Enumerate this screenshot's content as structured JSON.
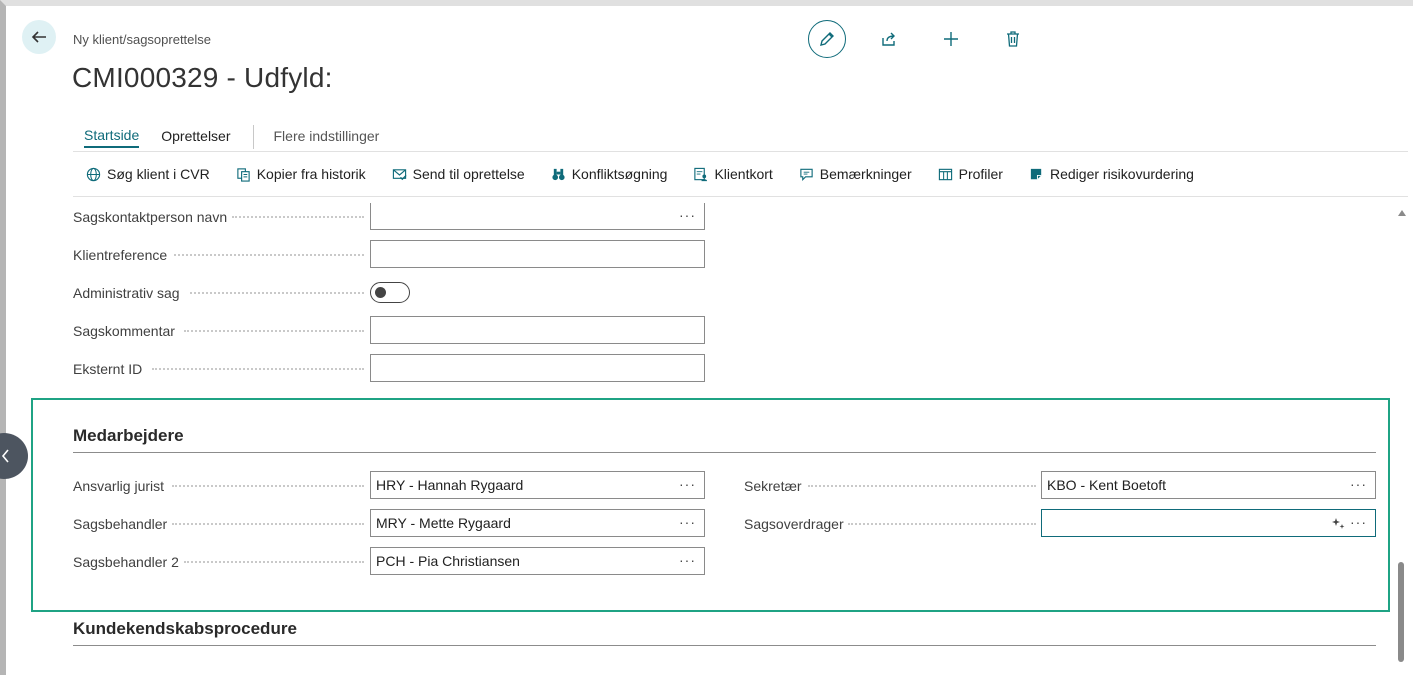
{
  "header": {
    "breadcrumb": "Ny klient/sagsoprettelse",
    "title": "CMI000329 - Udfyld:"
  },
  "tabs": [
    {
      "label": "Startside",
      "active": true
    },
    {
      "label": "Oprettelser",
      "active": false
    },
    {
      "label": "Flere indstillinger",
      "active": false
    }
  ],
  "actions": [
    {
      "label": "Søg klient i CVR",
      "icon": "globe-icon"
    },
    {
      "label": "Kopier fra historik",
      "icon": "copy-icon"
    },
    {
      "label": "Send til oprettelse",
      "icon": "send-mail-icon"
    },
    {
      "label": "Konfliktsøgning",
      "icon": "binoculars-icon"
    },
    {
      "label": "Klientkort",
      "icon": "card-user-icon"
    },
    {
      "label": "Bemærkninger",
      "icon": "comment-icon"
    },
    {
      "label": "Profiler",
      "icon": "columns-icon"
    },
    {
      "label": "Rediger risikovurdering",
      "icon": "document-edit-icon"
    }
  ],
  "fields": {
    "sagskontaktperson_navn": {
      "label": "Sagskontaktperson navn",
      "value": ""
    },
    "klientreference": {
      "label": "Klientreference",
      "value": ""
    },
    "administrativ_sag": {
      "label": "Administrativ sag",
      "value": false
    },
    "sagskommentar": {
      "label": "Sagskommentar",
      "value": ""
    },
    "eksternt_id": {
      "label": "Eksternt ID",
      "value": ""
    }
  },
  "medarbejdere": {
    "title": "Medarbejdere",
    "ansvarlig_jurist": {
      "label": "Ansvarlig jurist",
      "value": "HRY - Hannah Rygaard"
    },
    "sagsbehandler": {
      "label": "Sagsbehandler",
      "value": "MRY - Mette Rygaard"
    },
    "sagsbehandler2": {
      "label": "Sagsbehandler 2",
      "value": "PCH - Pia Christiansen"
    },
    "sekretaer": {
      "label": "Sekretær",
      "value": "KBO - Kent Boetoft"
    },
    "sagsoverdrager": {
      "label": "Sagsoverdrager",
      "value": ""
    }
  },
  "kundekendskab": {
    "title": "Kundekendskabsprocedure"
  },
  "ellipsis": "···",
  "colors": {
    "accent": "#0f6b7a",
    "highlight": "#1fa384"
  }
}
